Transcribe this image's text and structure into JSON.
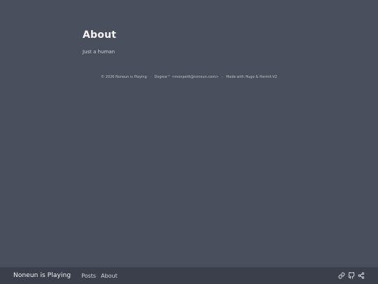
{
  "page": {
    "title": "About",
    "body": "Just a human"
  },
  "footer": {
    "copyright": "© 2026 Noneun is Playing",
    "separator": "·",
    "author": "Dogma™ <monpetit@noneun.com>",
    "made_with": "Made with Hugo & Hermit-V2"
  },
  "navbar": {
    "site_title": "Noneun is Playing",
    "menu": [
      {
        "label": "Posts"
      },
      {
        "label": "About"
      }
    ],
    "icons": [
      "link-icon",
      "github-icon",
      "share-icon"
    ]
  },
  "colors": {
    "background": "#494f5c",
    "navbar": "#3a3f4b",
    "text": "#dadadb"
  }
}
